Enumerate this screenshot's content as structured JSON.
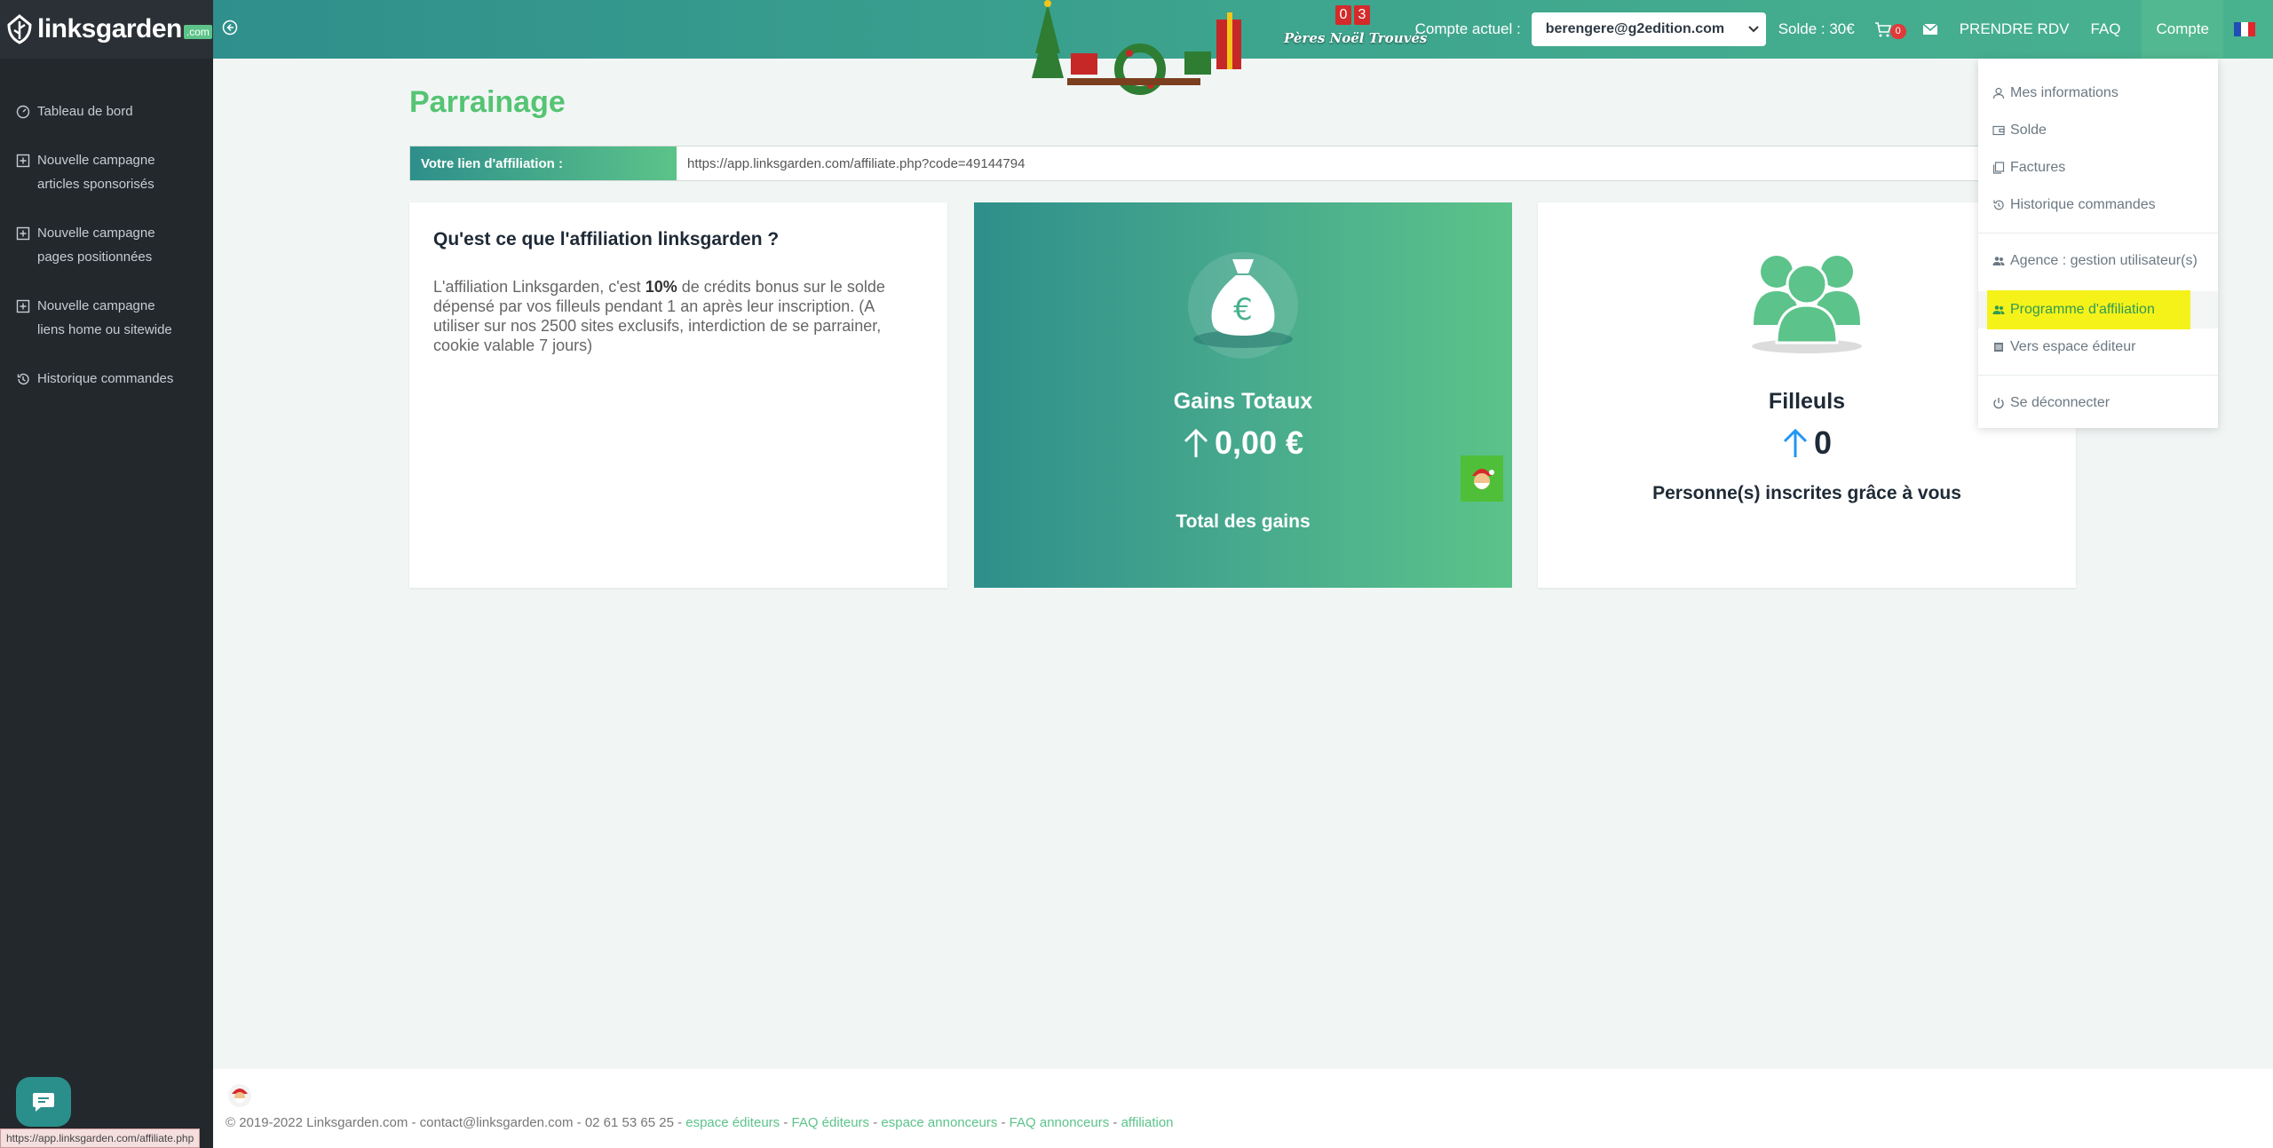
{
  "app": {
    "logo_text": "linksgarden",
    "logo_tld": ".com"
  },
  "sidebar": {
    "items": [
      {
        "label": "Tableau de bord",
        "icon": "dashboard-icon"
      },
      {
        "label": "Nouvelle campagne\narticles sponsorisés",
        "icon": "plus-square-icon"
      },
      {
        "label": "Nouvelle campagne\npages positionnées",
        "icon": "plus-square-icon"
      },
      {
        "label": "Nouvelle campagne\nliens home ou sitewide",
        "icon": "plus-square-icon"
      },
      {
        "label": "Historique commandes",
        "icon": "history-icon"
      }
    ]
  },
  "topbar": {
    "santa_counter": [
      "0",
      "3"
    ],
    "santa_label": "Pères Noël Trouvés",
    "account_label": "Compte actuel :",
    "account_value": "berengere@g2edition.com",
    "solde": "Solde : 30€",
    "cart_count": "0",
    "rdv": "PRENDRE RDV",
    "faq": "FAQ",
    "compte": "Compte"
  },
  "main": {
    "title": "Parrainage",
    "aff_label": "Votre lien d'affiliation :",
    "aff_url": "https://app.linksgarden.com/affiliate.php?code=49144794",
    "info_card": {
      "title": "Qu'est ce que l'affiliation linksgarden ?",
      "text_before": "L'affiliation Linksgarden, c'est ",
      "text_bold": "10%",
      "text_after": " de crédits bonus sur le solde dépensé par vos filleuls pendant 1 an après leur inscription. (A utiliser sur nos 2500 sites exclusifs, interdiction de se parrainer, cookie valable 7 jours)"
    },
    "gains_card": {
      "title": "Gains Totaux",
      "value": "0,00 €",
      "sub": "Total des gains"
    },
    "filleuls_card": {
      "title": "Filleuls",
      "value": "0",
      "sub": "Personne(s) inscrites grâce à vous"
    }
  },
  "dropdown": {
    "items": [
      {
        "label": "Mes informations",
        "icon": "user-icon"
      },
      {
        "label": "Solde",
        "icon": "wallet-icon"
      },
      {
        "label": "Factures",
        "icon": "invoice-icon"
      },
      {
        "label": "Historique commandes",
        "icon": "history-icon"
      },
      {
        "label": "Agence : gestion utilisateur(s)",
        "icon": "users-icon"
      },
      {
        "label": "Programme d'affiliation",
        "icon": "users-icon"
      },
      {
        "label": "Vers espace éditeur",
        "icon": "list-icon"
      },
      {
        "label": "Se déconnecter",
        "icon": "power-icon"
      }
    ]
  },
  "footer": {
    "copyright": "© 2019-2022 Linksgarden.com - contact@linksgarden.com - 02 61 53 65 25 - ",
    "links": [
      "espace éditeurs",
      "FAQ éditeurs",
      "espace annonceurs",
      "FAQ annonceurs",
      "affiliation"
    ],
    "sep": " - "
  },
  "status_url": "https://app.linksgarden.com/affiliate.php",
  "colors": {
    "brand_green": "#55c473",
    "brand_teal": "#2e8f8b",
    "sidebar_bg": "#23282d",
    "highlight": "#f5f21a"
  }
}
